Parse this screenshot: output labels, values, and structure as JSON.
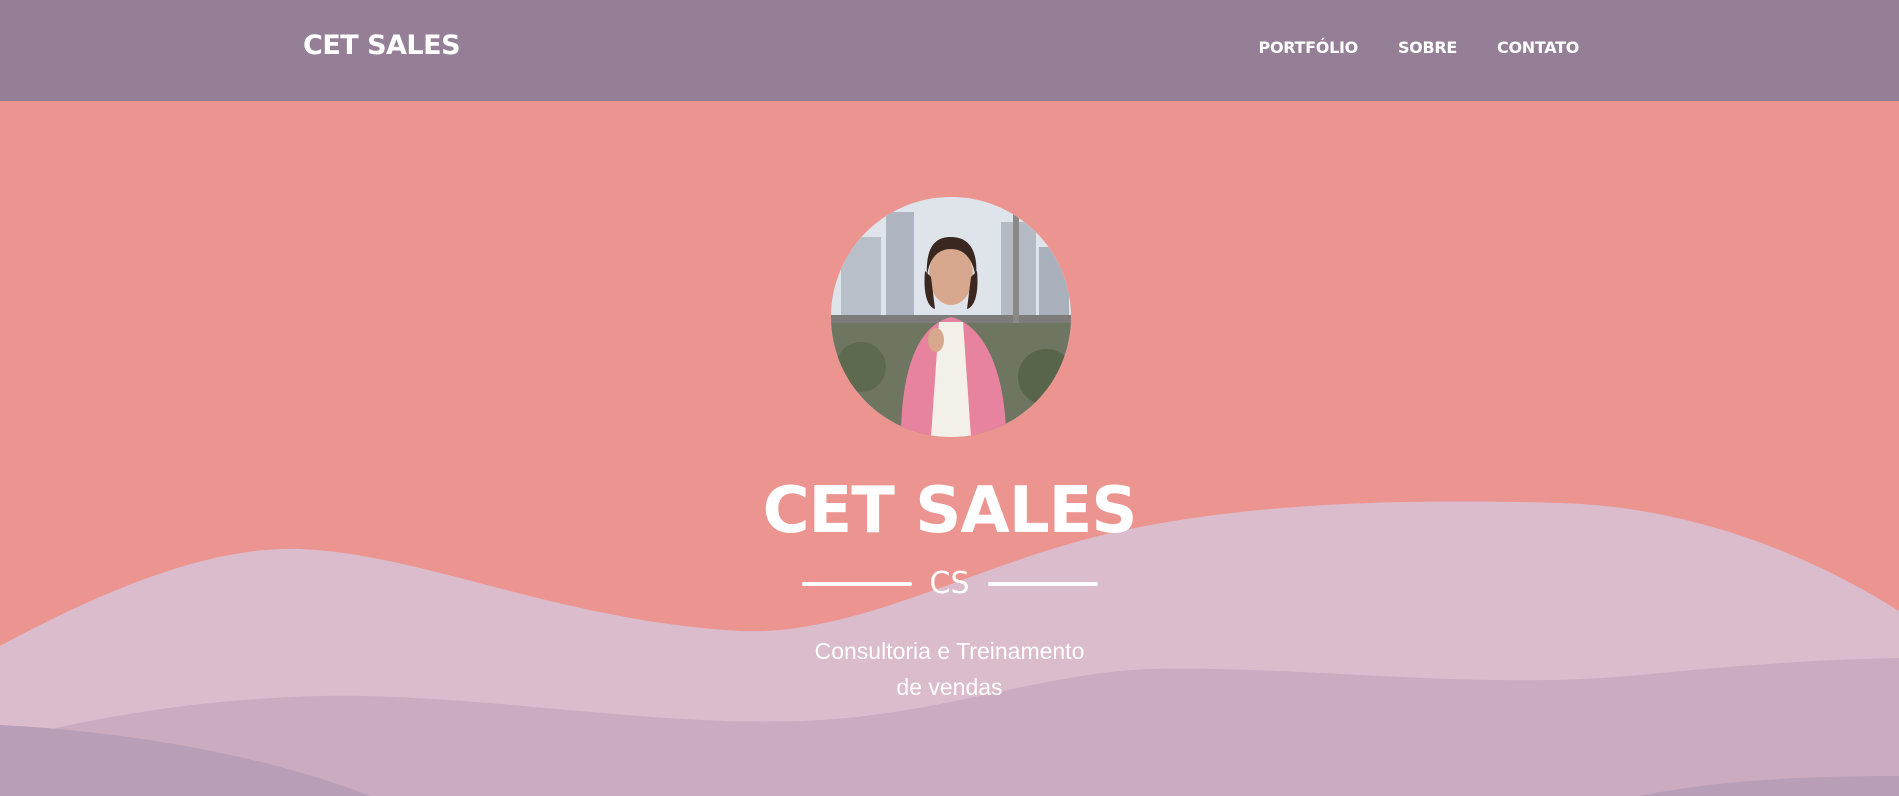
{
  "nav": {
    "brand": "CET SALES",
    "links": [
      "PORTFÓLIO",
      "SOBRE",
      "CONTATO"
    ]
  },
  "hero": {
    "title": "CET SALES",
    "divider_text": "CS",
    "subtitle_line1": "Consultoria e Treinamento",
    "subtitle_line2": "de vendas"
  },
  "colors": {
    "navbar": "#957f97",
    "hero_background": "#ec9590",
    "wave_light": "#dabccc",
    "wave_mid": "#caabc0",
    "wave_dark": "#b89eb6",
    "text": "#ffffff"
  },
  "icons": {
    "avatar": "profile-photo-woman-pink-blazer"
  }
}
